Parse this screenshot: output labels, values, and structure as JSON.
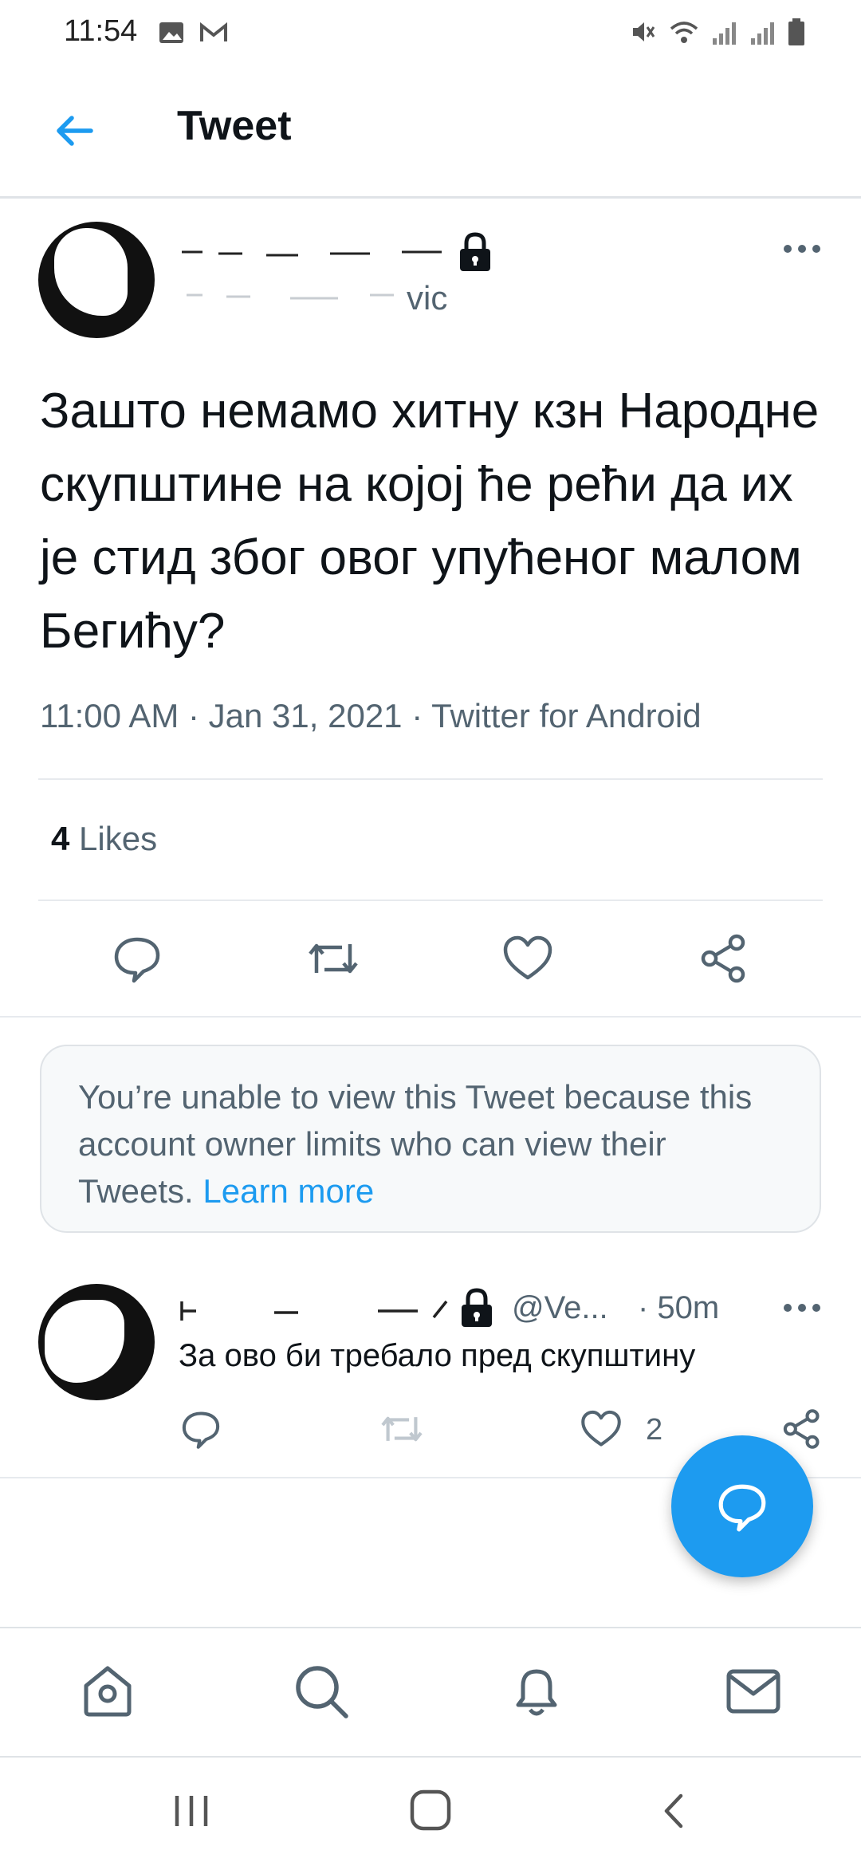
{
  "status": {
    "time": "11:54"
  },
  "header": {
    "title": "Tweet"
  },
  "tweet": {
    "handle_visible": "vic",
    "text": "Зашто немамо хитну кзн Народне скупштине на којој ће рећи да их је стид због овог упућеног малом Бегићу?",
    "timestamp": "11:00 AM · Jan 31, 2021",
    "source": "Twitter for Android",
    "likes_count": "4",
    "likes_label": "Likes"
  },
  "notice": {
    "text": "You’re unable to view this Tweet because this account owner limits who can view their Tweets. ",
    "link": "Learn more"
  },
  "reply": {
    "handle": "@Ve...",
    "time": "· 50m",
    "text": "За ово би требало пред скупштину",
    "likes": "2"
  },
  "colors": {
    "accent": "#1d9bf0",
    "muted": "#536471",
    "text": "#0f1419"
  },
  "icons": {
    "back": "arrow-left-icon",
    "lock": "lock-icon",
    "more": "more-horizontal-icon",
    "reply": "comment-icon",
    "retweet": "retweet-icon",
    "like": "heart-icon",
    "share": "share-icon",
    "compose": "compose-reply-icon",
    "home": "home-icon",
    "search": "search-icon",
    "notifications": "bell-icon",
    "messages": "mail-icon"
  }
}
